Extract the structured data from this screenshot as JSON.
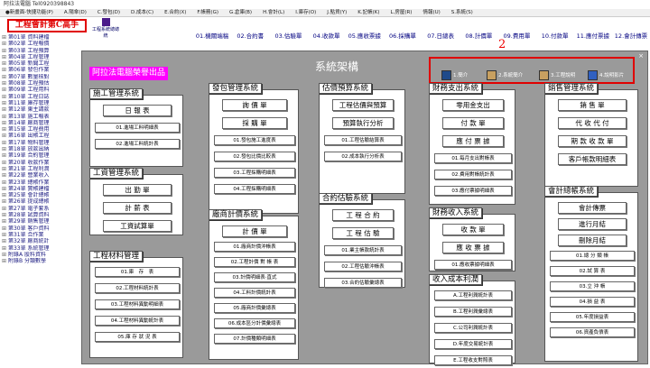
{
  "window": {
    "title": "阿拉法電腦 Tel0920398843"
  },
  "menu": [
    "●新畫面-快捷功能(P)",
    "A.陽傘(D)",
    "C.發包(D)",
    "D.成本(C)",
    "E.合約(X)",
    "F.帳務(G)",
    "G.倉庫(B)",
    "H.會計(L)",
    "I.庫存(O)",
    "J.點貨(Y)",
    "K.記帳(K)",
    "L.房屋(R)",
    "情報(U)",
    "S.系統(S)"
  ],
  "logo": "工程會計第C高手",
  "tb_icon": "工程系統總總統",
  "sidebar": [
    "第01單 資料建檔",
    "第02單 工程報價",
    "第03單 工程預算",
    "第04單 工程管理",
    "第05單 新聞工程",
    "第06單 發包作業",
    "第07單 數量核對",
    "第08單 工程預估",
    "第09單 工程用料",
    "第10單 工程日誌",
    "第11單 庫存管理",
    "第12單 東主請款",
    "第13單 施工報表",
    "第14單 廠商管理",
    "第15單 工程費用",
    "第16單 出帳工程",
    "第17單 物料管理",
    "第18單 放款出納",
    "第19單 合約管理",
    "第20單 收款作業",
    "第21單 工程利潤",
    "第22單 營業收入",
    "第23單 總帳作業",
    "第24單 實帳建檔",
    "第25單 會計總帳",
    "第26單 提成總帳",
    "第27單 電子套系",
    "第28單 試算資料",
    "第29單 銷售管理",
    "第30單 客戶資料",
    "第31單 合作業",
    "第32單 廠商統計",
    "第33單 系統管理",
    "附錄A 股料資料",
    "附錄B 分類數學"
  ],
  "topnav": [
    "01.機關端稿",
    "02.合約書",
    "03.估驗單",
    "04.收款單",
    "05.應收票據",
    "06.採購單",
    "07.日總表",
    "08.計價單",
    "09.費用單",
    "10.付款單",
    "11.應付票據",
    "12.會計傳票"
  ],
  "annot": "2",
  "panel": {
    "title": "系統架構",
    "brand": "阿拉法電腦榮譽出品",
    "close": "×",
    "icons": [
      "1.簡介",
      "2.系統簡介",
      "3.工程說明",
      "4.說明影片"
    ],
    "groups": [
      {
        "title": "施工管理系統",
        "buttons": [
          "日 報 表",
          "01.進場工料明細表",
          "02.進場工料統計表"
        ]
      },
      {
        "title": "工資管理系統",
        "buttons": [
          "出 勤 單",
          "計 薪 表",
          "工資試算單"
        ]
      },
      {
        "title": "工程材料管理",
        "buttons": [
          "01.庫　存　表",
          "02.工程材料統計表",
          "03.工程材料異動明細表",
          "04.工程材料異動統計表",
          "05.庫 存 狀 況 表"
        ]
      },
      {
        "title": "發包管理系統",
        "buttons": [
          "詢 價 單",
          "採 購 單",
          "01.發包施工進度表",
          "02.發包比價比較表",
          "03.工程採購明細表",
          "04.工程採購明細表"
        ]
      },
      {
        "title": "廠商計價系統",
        "buttons": [
          "計 價 單",
          "01.廠商計價沖帳表",
          "02.工程計價 對 帳 表",
          "03.計價明細表‧直式",
          "04.工料計價統計表",
          "05.廠商計價彙總表",
          "06.成本區分計價彙總表",
          "07.計價種類明細表"
        ]
      },
      {
        "title": "估價預算系統",
        "buttons": [
          "工程估價與預算",
          "預算執行分析",
          "01.工程估驗結算表",
          "02.成本執行分析表"
        ]
      },
      {
        "title": "合約估驗系統",
        "buttons": [
          "工 程 合 約",
          "工 程 估 驗",
          "01.業主帳款統計表",
          "02.工程估驗沖帳表",
          "03.合約估驗彙總表"
        ]
      },
      {
        "title": "財務支出系統",
        "buttons": [
          "零用金支出",
          "付 款 單",
          "應 付 票 據",
          "01.每月支出對帳表",
          "02.費用對帳統計表",
          "03.應付票據明細表"
        ]
      },
      {
        "title": "財務收入系統",
        "buttons": [
          "收 款 單",
          "應 收 票 據",
          "01.應收票據明細表"
        ]
      },
      {
        "title": "收入成本利潤",
        "buttons": [
          "A.工程利潤統計表",
          "B.工程利潤彙總表",
          "C.公司利潤統計表",
          "D.年度交易統計表",
          "E.工程收支對照表"
        ]
      },
      {
        "title": "銷售管理系統",
        "buttons": [
          "銷 售 單",
          "代 收 代 付",
          "期 款 收 款 單",
          "客戶帳款明細表"
        ]
      },
      {
        "title": "會計總帳系統",
        "buttons": [
          "會計傳票",
          "進行月結",
          "刪除月結",
          "01.總 分 類 帳",
          "02.試 算 表",
          "03.立 沖 帳",
          "04.損 益 表",
          "05.年度損益表",
          "06.資產負債表"
        ]
      }
    ]
  },
  "colors": {
    "panel": "#9a9a9a",
    "annotation": "#e00000",
    "brand": "#ff00ff"
  }
}
